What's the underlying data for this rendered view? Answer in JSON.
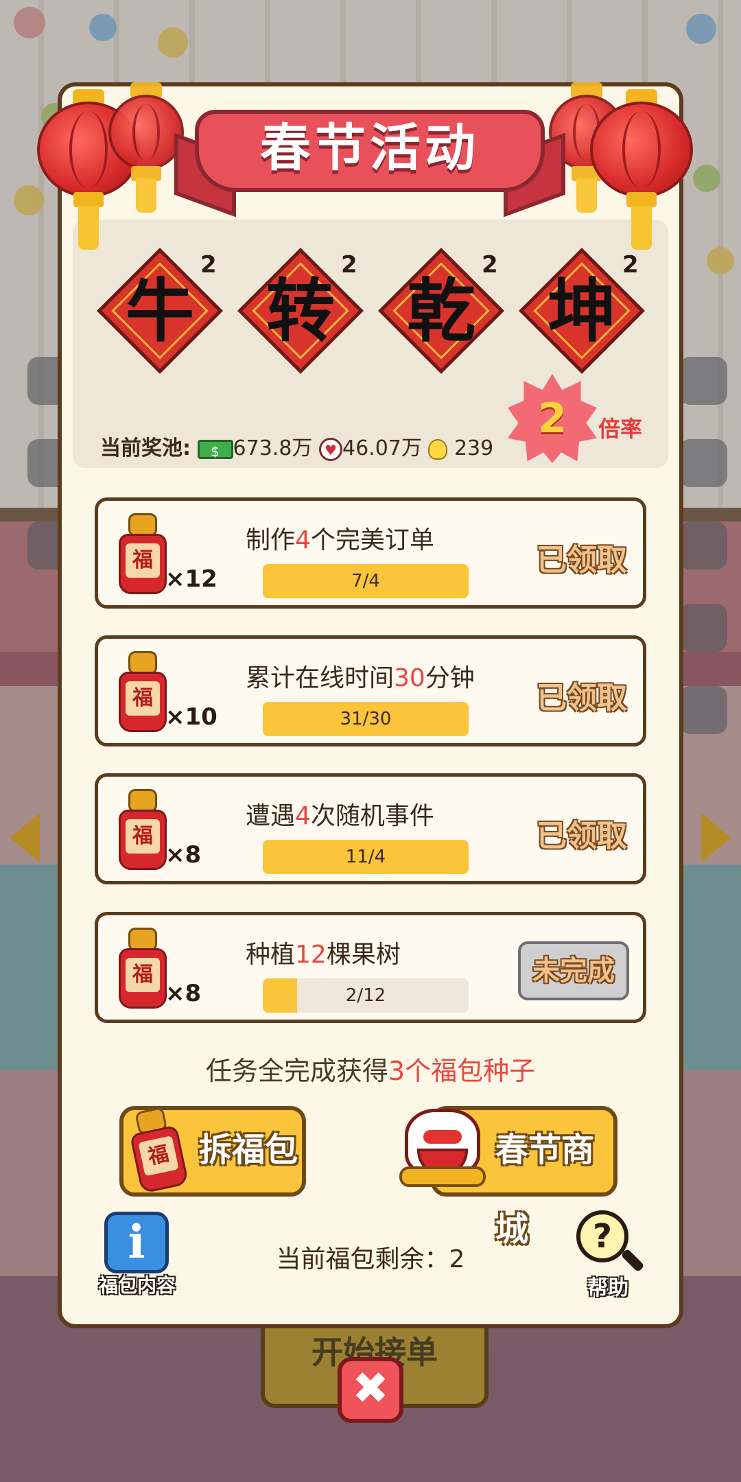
{
  "title": "春节活动",
  "cards": [
    {
      "char": "牛",
      "count": "2"
    },
    {
      "char": "转",
      "count": "2"
    },
    {
      "char": "乾",
      "count": "2"
    },
    {
      "char": "坤",
      "count": "2"
    }
  ],
  "pool": {
    "label": "当前奖池:",
    "money_icon": "$",
    "money": "673.8万",
    "heart_icon": "♥",
    "heart": "46.07万",
    "bulb": "239"
  },
  "multiplier": {
    "value": "2",
    "label": "倍率"
  },
  "tasks": [
    {
      "pre": "制作",
      "num": "4",
      "post": "个完美订单",
      "reward": "×12",
      "progress": 1.0,
      "progress_text": "7/4",
      "status": "已领取",
      "done": true
    },
    {
      "pre": "累计在线时间",
      "num": "30",
      "post": "分钟",
      "reward": "×10",
      "progress": 1.0,
      "progress_text": "31/30",
      "status": "已领取",
      "done": true
    },
    {
      "pre": "遭遇",
      "num": "4",
      "post": "次随机事件",
      "reward": "×8",
      "progress": 1.0,
      "progress_text": "11/4",
      "status": "已领取",
      "done": true
    },
    {
      "pre": "种植",
      "num": "12",
      "post": "棵果树",
      "reward": "×8",
      "progress": 0.1667,
      "progress_text": "2/12",
      "status": "未完成",
      "done": false
    }
  ],
  "fu_char": "福",
  "completion": {
    "pre": "任务全完成获得",
    "highlight": "3个福包种子"
  },
  "buttons": {
    "open": "拆福包",
    "shop": "春节商城",
    "info": "福包内容",
    "help": "帮助",
    "help_glyph": "?",
    "info_glyph": "i",
    "close_glyph": "✖"
  },
  "remaining": "当前福包剩余：2",
  "background": {
    "start_button": "开始接单"
  }
}
